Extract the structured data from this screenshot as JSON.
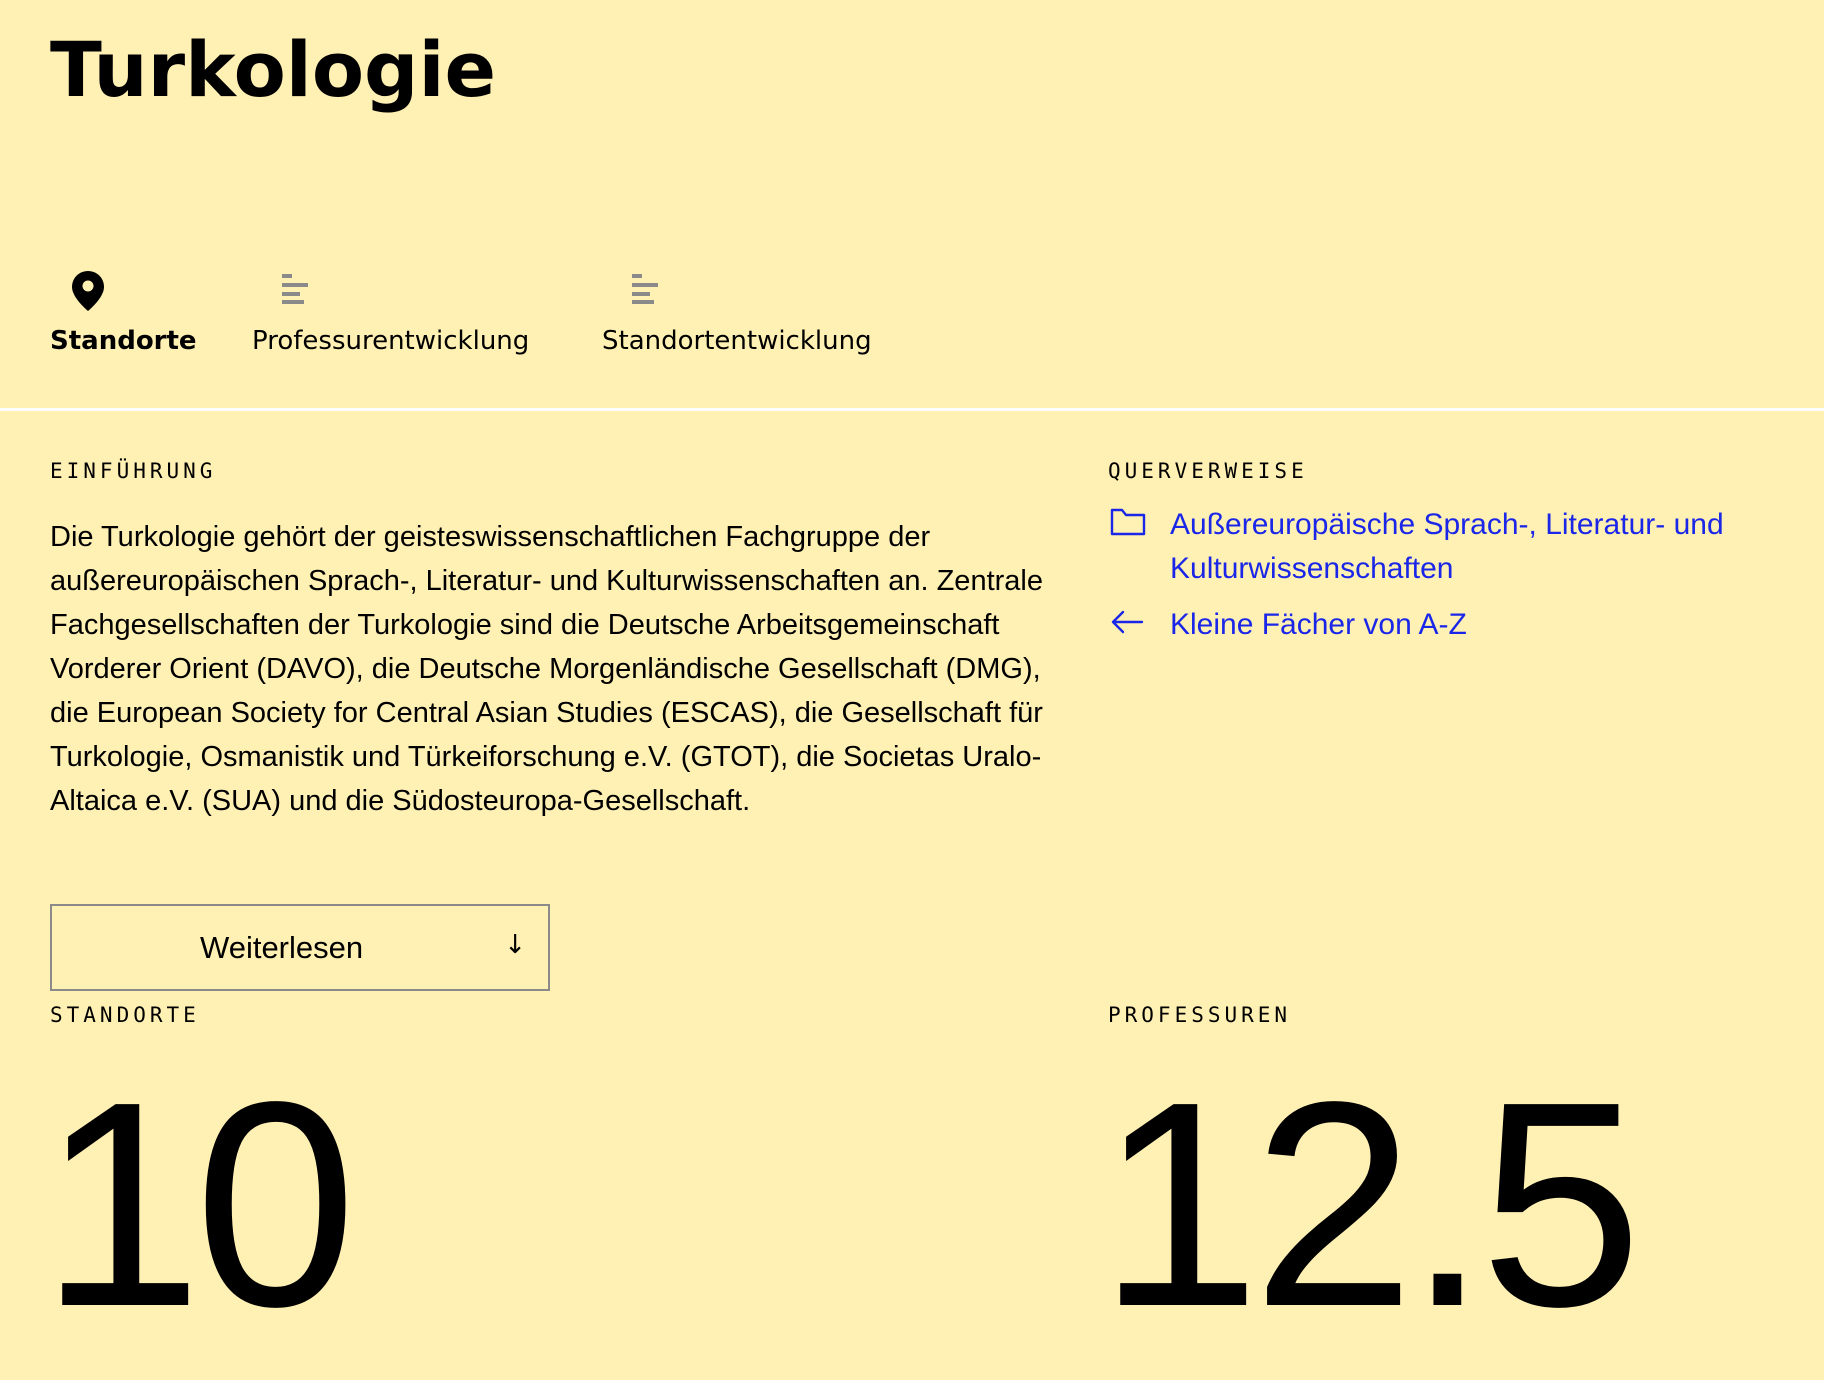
{
  "page": {
    "title": "Turkologie"
  },
  "tabs": [
    {
      "label": "Standorte",
      "icon": "location-pin-icon",
      "active": true
    },
    {
      "label": "Professurentwicklung",
      "icon": "bar-chart-icon",
      "active": false
    },
    {
      "label": "Standortentwicklung",
      "icon": "bar-chart-icon",
      "active": false
    }
  ],
  "intro": {
    "heading": "EINFÜHRUNG",
    "text": "Die Turkologie gehört der geisteswissenschaftlichen Fachgruppe der außereuropäischen Sprach-, Literatur- und Kulturwissenschaften an. Zentrale Fachgesellschaften der Turkologie sind die Deutsche Arbeitsgemeinschaft Vorderer Orient (DAVO), die Deutsche Morgenländische Gesellschaft (DMG), die European Society for Central Asian Studies (ESCAS), die Gesellschaft für Turkologie, Osmanistik und Türkeiforschung e.V. (GTOT), die Societas Uralo-Altaica e.V. (SUA) und die Südosteuropa-Gesellschaft.",
    "more_label": "Weiterlesen",
    "more_icon": "↓"
  },
  "crossrefs": {
    "heading": "QUERVERWEISE",
    "items": [
      {
        "label": "Außereuropäische Sprach-, Literatur- und Kulturwissenschaften",
        "icon": "folder-icon"
      },
      {
        "label": "Kleine Fächer von A-Z",
        "icon": "arrow-left-icon"
      }
    ]
  },
  "stats": {
    "standorte_label": "STANDORTE",
    "standorte_value": "10",
    "professuren_label": "PROFESSUREN",
    "professuren_value": "12.5"
  },
  "colors": {
    "background": "#fff0b3",
    "link": "#1a27e8",
    "divider": "#ffffff",
    "icon_gray": "#8a8a8a"
  }
}
